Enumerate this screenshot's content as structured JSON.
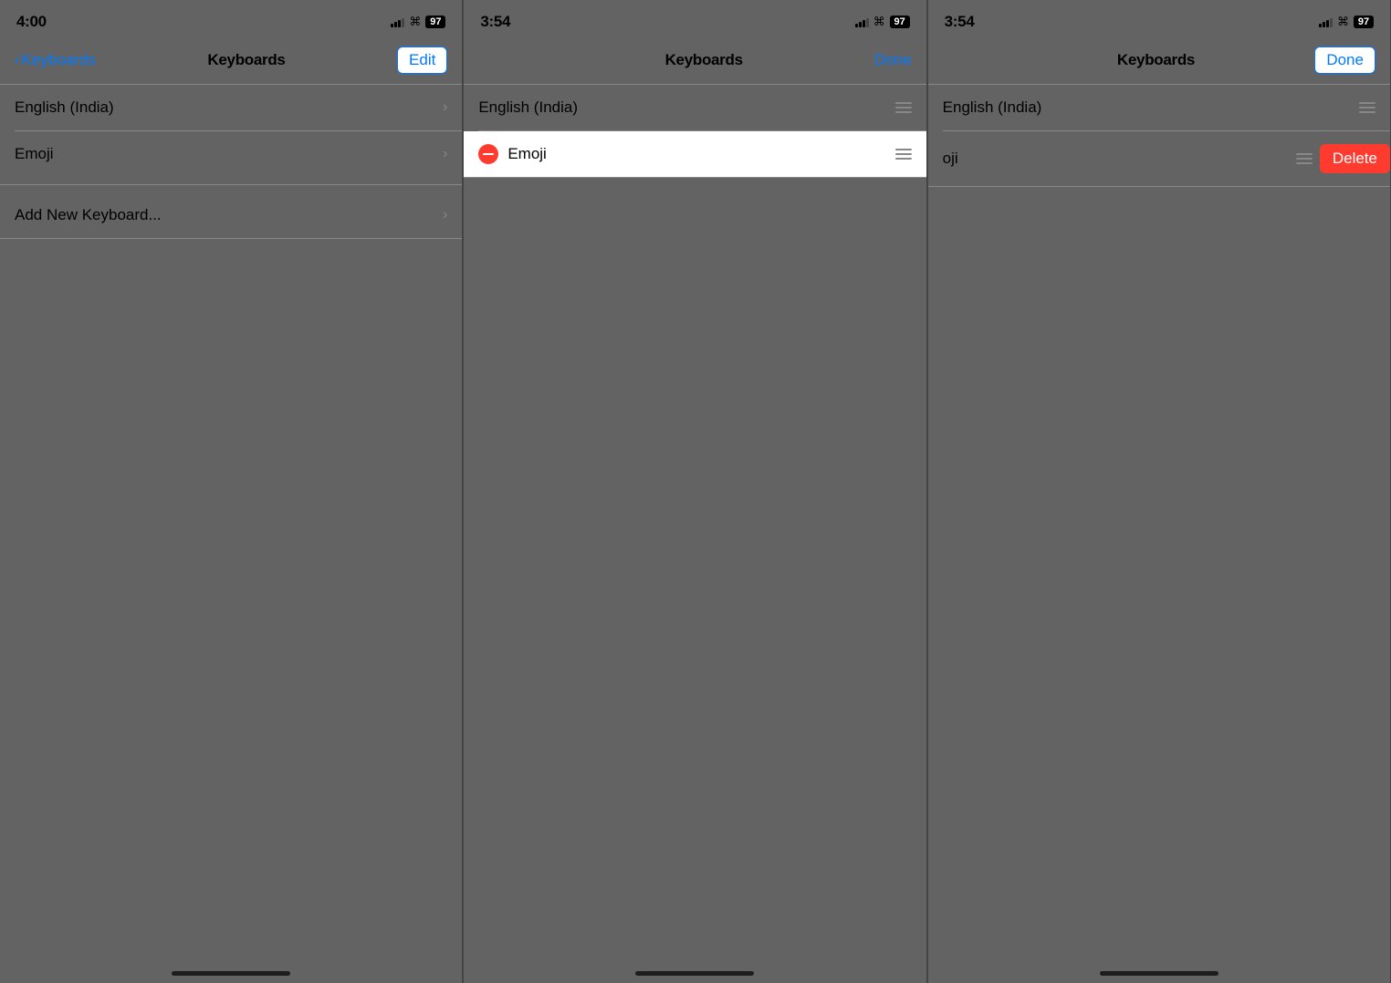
{
  "panel1": {
    "status": {
      "time": "4:00",
      "battery": "97"
    },
    "nav": {
      "back_label": "Keyboards",
      "title": "Keyboards",
      "action_label": "Edit"
    },
    "items": [
      {
        "label": "English (India)",
        "type": "chevron"
      },
      {
        "label": "Emoji",
        "type": "chevron"
      }
    ],
    "add_item": {
      "label": "Add New Keyboard...",
      "type": "chevron"
    }
  },
  "panel2": {
    "status": {
      "time": "3:54",
      "battery": "97"
    },
    "nav": {
      "title": "Keyboards",
      "action_label": "Done"
    },
    "items": [
      {
        "label": "English (India)",
        "type": "drag"
      },
      {
        "label": "Emoji",
        "type": "drag",
        "highlighted": true,
        "minus": true
      }
    ]
  },
  "panel3": {
    "status": {
      "time": "3:54",
      "battery": "97"
    },
    "nav": {
      "title": "Keyboards",
      "action_label": "Done"
    },
    "items": [
      {
        "label": "English (India)",
        "type": "drag"
      },
      {
        "label": "oji",
        "type": "drag",
        "delete": true
      }
    ]
  },
  "icons": {
    "chevron_right": "›",
    "back_chevron": "‹",
    "wifi": "▲"
  }
}
